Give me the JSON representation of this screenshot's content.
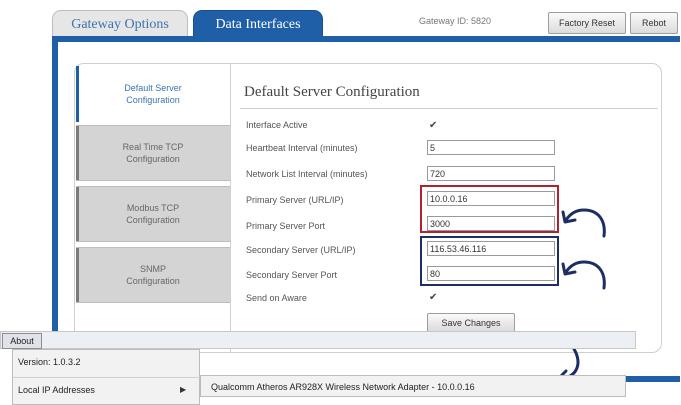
{
  "tabs": {
    "gateway_options": "Gateway Options",
    "data_interfaces": "Data Interfaces"
  },
  "header": {
    "gateway_id": "Gateway ID: 5820",
    "factory_reset": "Factory Reset",
    "reboot": "Rebot"
  },
  "sidebar": {
    "items": [
      {
        "line1": "Default Server",
        "line2": "Configuration"
      },
      {
        "line1": "Real Time TCP",
        "line2": "Configuration"
      },
      {
        "line1": "Modbus TCP",
        "line2": "Configuration"
      },
      {
        "line1": "SNMP",
        "line2": "Configuration"
      }
    ]
  },
  "form": {
    "title": "Default Server Configuration",
    "interface_active_label": "Interface Active",
    "heartbeat_label": "Heartbeat Interval (minutes)",
    "heartbeat_value": "5",
    "network_list_label": "Network List Interval (minutes)",
    "network_list_value": "720",
    "primary_server_label": "Primary Server (URL/IP)",
    "primary_server_value": "10.0.0.16",
    "primary_port_label": "Primary Server Port",
    "primary_port_value": "3000",
    "secondary_server_label": "Secondary Server (URL/IP)",
    "secondary_server_value": "116.53.46.116",
    "secondary_port_label": "Secondary Server Port",
    "secondary_port_value": "80",
    "send_on_aware_label": "Send on Aware",
    "save_button": "Save Changes"
  },
  "context_menu": {
    "about": "About",
    "version": "Version: 1.0.3.2",
    "local_ip": "Local IP Addresses",
    "submenu_item": "Qualcomm Atheros AR928X Wireless Network Adapter - 10.0.0.16"
  },
  "colors": {
    "accent_blue": "#1f5fa8",
    "highlight_red": "#b02232",
    "highlight_navy": "#1d2e66"
  }
}
